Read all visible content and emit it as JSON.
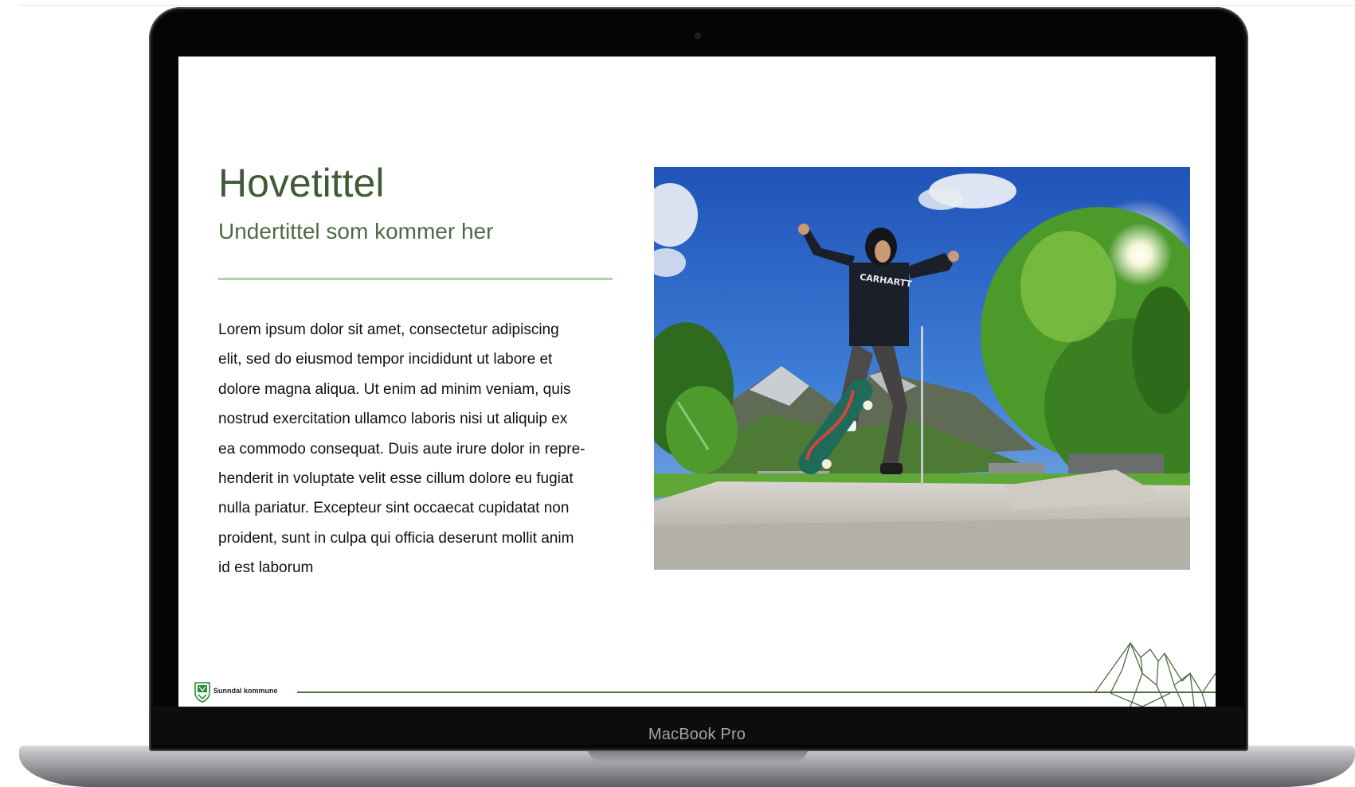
{
  "device": {
    "model_label": "MacBook Pro"
  },
  "slide": {
    "title": "Hovetittel",
    "subtitle": "Undertittel som kommer her",
    "body": "Lorem ipsum dolor sit amet, consectetur adipiscing\nelit, sed do eiusmod tempor incididunt ut labore et\ndolore magna aliqua. Ut enim ad minim veniam, quis\nnostrud exercitation ullamco laboris nisi ut aliquip ex\nea commodo consequat. Duis aute irure dolor in repre-\nhenderit in voluptate velit esse cillum dolore eu fugiat\nnulla pariatur. Excepteur sint occaecat cupidatat non\nproident, sunt in culpa qui officia deserunt mollit anim\nid est laborum",
    "photo": {
      "icon": "skateboarder-photo",
      "shirt_text": "CARHARTT"
    },
    "footer": {
      "org_name": "Sunndal kommune",
      "logo_icon": "municipal-shield-icon",
      "art_icon": "mountain-outline-icon"
    }
  },
  "colors": {
    "title_green": "#3f5a36",
    "divider_green": "#a9d6a6",
    "footer_line_green": "#4d6c44"
  }
}
